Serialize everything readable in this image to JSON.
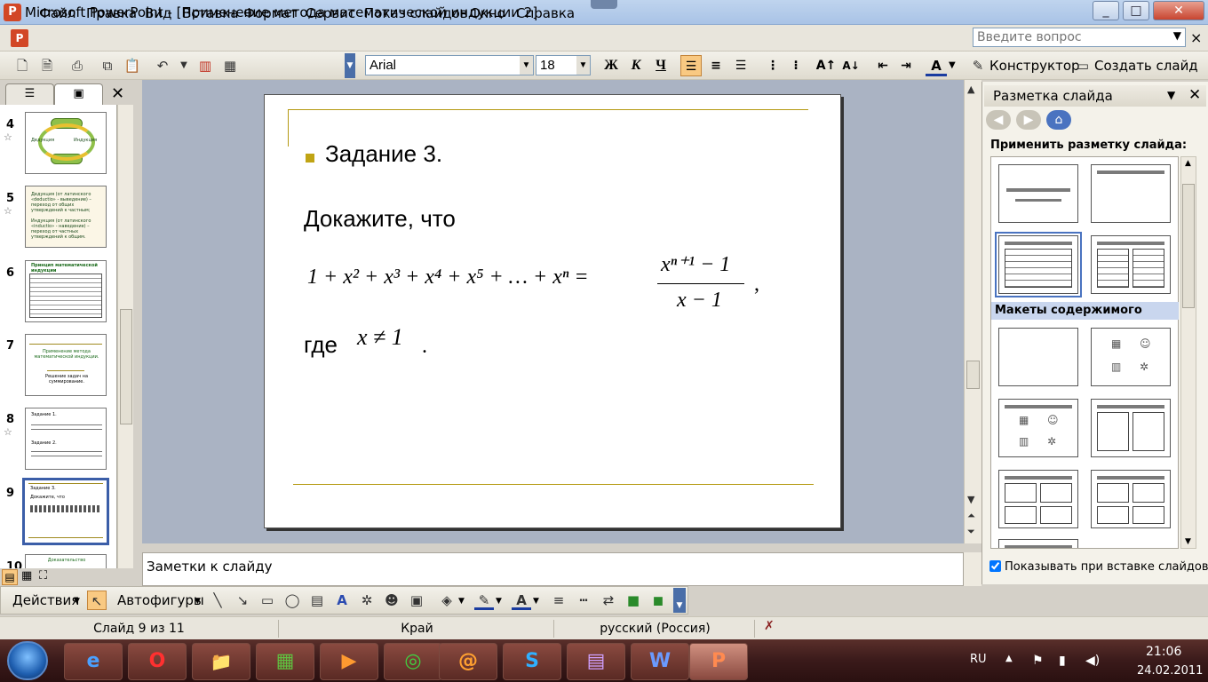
{
  "window": {
    "app_icon": "P",
    "title": "Microsoft PowerPoint - [Применение метода математической индукции 2]",
    "btn_min": "_",
    "btn_max": "□",
    "btn_close": "✕",
    "btn_min_doc": "_",
    "btn_max_doc": "▫",
    "btn_close_doc": "×"
  },
  "menu": {
    "items": [
      "Файл",
      "Правка",
      "Вид",
      "Вставка",
      "Формат",
      "Сервис",
      "Показ слайдов",
      "Окно",
      "Справка"
    ],
    "ask_placeholder": "Введите вопрос"
  },
  "toolbar": {
    "font": "Arial",
    "size": "18",
    "bold": "Ж",
    "italic": "К",
    "underline": "Ч",
    "designer": "Конструктор",
    "new_slide": "Создать слайд"
  },
  "thumbnails": [
    {
      "num": "4",
      "lines": [
        "Дедукция",
        "Индукция"
      ]
    },
    {
      "num": "5",
      "lines": [
        "Дедукция (от латинского «deductio» - выведение) – переход от общих утверждений к частным;",
        "Индукция (от латинского «inductio» - наведение) – переход от частных утверждений к общим."
      ]
    },
    {
      "num": "6",
      "lines": [
        "Принцип математической индукции"
      ]
    },
    {
      "num": "7",
      "lines": [
        "Применение метода математической индукции.",
        "Решение задач на суммирование."
      ]
    },
    {
      "num": "8",
      "lines": [
        "Задание 1.",
        "Задание 2."
      ]
    },
    {
      "num": "9",
      "lines": [
        "Задание 3.",
        "Докажите, что"
      ]
    },
    {
      "num": "10",
      "lines": [
        "Доказательство"
      ]
    }
  ],
  "slide": {
    "heading": "Задание 3.",
    "line1": "Докажите, что",
    "formula_lhs": "1 + x² + x³ + x⁴ + x⁵ + … + xⁿ =",
    "formula_num": "xⁿ⁺¹ − 1",
    "formula_den": "x − 1",
    "comma": ",",
    "where": "где",
    "condition": "x ≠ 1",
    "period": "."
  },
  "notes": {
    "placeholder": "Заметки к слайду"
  },
  "taskpane": {
    "title": "Разметка слайда",
    "apply_label": "Применить разметку слайда:",
    "section_content": "Макеты содержимого",
    "show_on_insert": "Показывать при вставке слайдов",
    "show_on_insert_checked": true
  },
  "drawbar": {
    "actions": "Действия",
    "autoshapes": "Автофигуры"
  },
  "status": {
    "slide": "Слайд 9 из 11",
    "design": "Край",
    "language": "русский (Россия)"
  },
  "taskbar": {
    "lang": "RU",
    "time": "21:06",
    "date": "24.02.2011",
    "apps": [
      "e",
      "O",
      "📁",
      "▦",
      "▶",
      "◎",
      "@",
      "S",
      "▤",
      "W",
      "P"
    ]
  },
  "colors": {
    "accent_gold": "#b59a13",
    "selection_blue": "#3b5ea8",
    "slide_bg": "#ffffff",
    "workspace": "#aab3c3"
  }
}
